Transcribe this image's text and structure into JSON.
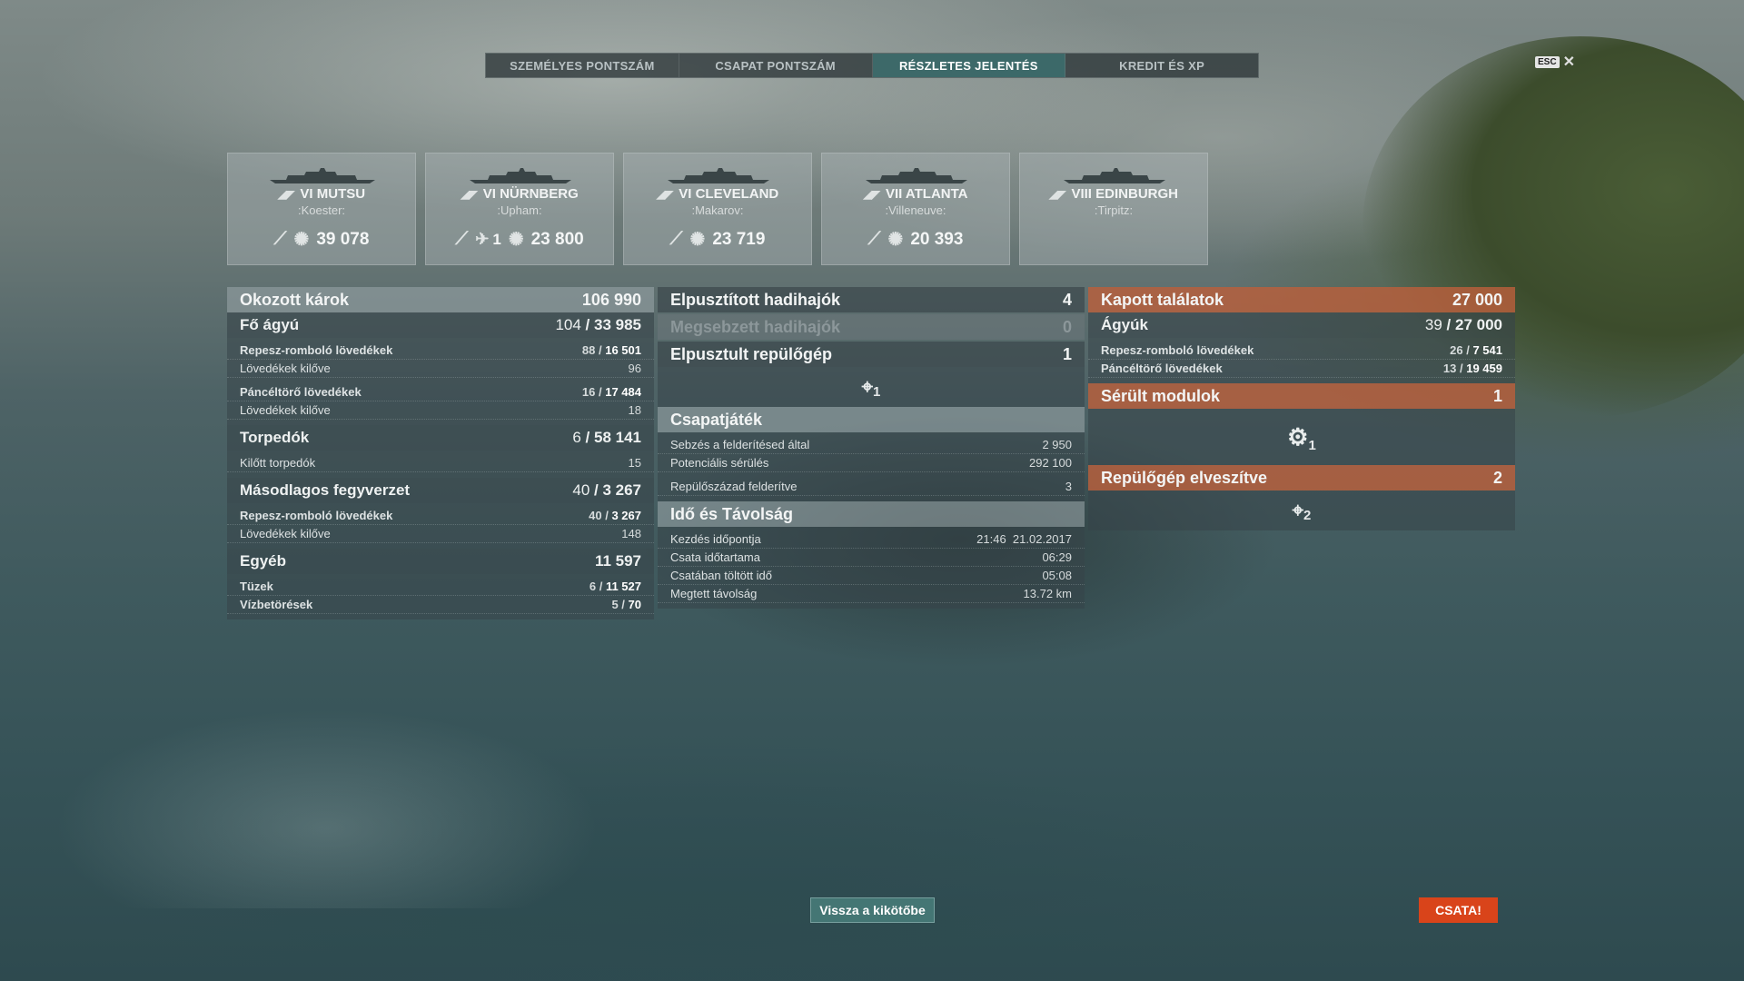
{
  "tabs": [
    {
      "label": "SZEMÉLYES PONTSZÁM"
    },
    {
      "label": "CSAPAT PONTSZÁM"
    },
    {
      "label": "RÉSZLETES JELENTÉS"
    },
    {
      "label": "KREDIT ÉS XP"
    }
  ],
  "active_tab": "RÉSZLETES JELENTÉS",
  "esc": {
    "key": "ESC",
    "close": "✕"
  },
  "ships": [
    {
      "tier": "VI",
      "name": "MUTSU",
      "player": ":Koester:",
      "damage": "39 078",
      "plane_kills": ""
    },
    {
      "tier": "VI",
      "name": "NÜRNBERG",
      "player": ":Upham:",
      "damage": "23 800",
      "plane_kills": "1"
    },
    {
      "tier": "VI",
      "name": "CLEVELAND",
      "player": ":Makarov:",
      "damage": "23 719",
      "plane_kills": ""
    },
    {
      "tier": "VII",
      "name": "ATLANTA",
      "player": ":Villeneuve:",
      "damage": "20 393",
      "plane_kills": ""
    },
    {
      "tier": "VIII",
      "name": "EDINBURGH",
      "player": ":Tirpitz:",
      "damage": "",
      "plane_kills": ""
    }
  ],
  "left": {
    "title": "Okozott károk",
    "total": "106 990",
    "main": {
      "label": "Fő ágyú",
      "hits": "104",
      "damage": "33 985"
    },
    "he": {
      "label": "Repesz-romboló lövedékek",
      "hits": "88",
      "damage": "16 501"
    },
    "he_fired": {
      "label": "Lövedékek kilőve",
      "value": "96"
    },
    "ap": {
      "label": "Páncéltörő lövedékek",
      "hits": "16",
      "damage": "17 484"
    },
    "ap_fired": {
      "label": "Lövedékek kilőve",
      "value": "18"
    },
    "torp": {
      "label": "Torpedók",
      "hits": "6",
      "damage": "58 141"
    },
    "torp_fired": {
      "label": "Kilőtt torpedók",
      "value": "15"
    },
    "secondary": {
      "label": "Másodlagos fegyverzet",
      "hits": "40",
      "damage": "3 267"
    },
    "sec_he": {
      "label": "Repesz-romboló lövedékek",
      "hits": "40",
      "damage": "3 267"
    },
    "sec_fired": {
      "label": "Lövedékek kilőve",
      "value": "148"
    },
    "other": {
      "label": "Egyéb",
      "value": "11 597"
    },
    "fires": {
      "label": "Tüzek",
      "hits": "6",
      "damage": "11 527"
    },
    "floods": {
      "label": "Vízbetörések",
      "hits": "5",
      "damage": "70"
    }
  },
  "middle": {
    "destroyed": {
      "label": "Elpusztított hadihajók",
      "value": "4"
    },
    "damaged": {
      "label": "Megsebzett hadihajók",
      "value": "0"
    },
    "planes": {
      "label": "Elpusztult repülőgép",
      "value": "1"
    },
    "planes_icon_count": "1",
    "team": {
      "label": "Csapatjáték"
    },
    "spot_damage": {
      "label": "Sebzés a felderítésed által",
      "value": "2 950"
    },
    "potential": {
      "label": "Potenciális sérülés",
      "value": "292 100"
    },
    "squadron": {
      "label": "Repülőszázad felderítve",
      "value": "3"
    },
    "time": {
      "label": "Idő és Távolság"
    },
    "start": {
      "label": "Kezdés időpontja",
      "value": "21:46  21.02.2017"
    },
    "duration": {
      "label": "Csata időtartama",
      "value": "06:29"
    },
    "alive": {
      "label": "Csatában töltött idő",
      "value": "05:08"
    },
    "distance": {
      "label": "Megtett távolság",
      "value": "13.72 km"
    }
  },
  "right": {
    "received": {
      "label": "Kapott találatok",
      "value": "27 000"
    },
    "guns": {
      "label": "Ágyúk",
      "hits": "39",
      "damage": "27 000"
    },
    "he": {
      "label": "Repesz-romboló lövedékek",
      "hits": "26",
      "damage": "7 541"
    },
    "ap": {
      "label": "Páncéltörő lövedékek",
      "hits": "13",
      "damage": "19 459"
    },
    "modules": {
      "label": "Sérült modulok",
      "value": "1"
    },
    "modules_icon_count": "1",
    "planes_lost": {
      "label": "Repülőgép elveszítve",
      "value": "2"
    },
    "planes_lost_icon_count": "2"
  },
  "buttons": {
    "back": "Vissza a kikötőbe",
    "battle": "CSATA!"
  },
  "colors": {
    "active_tab": "#3c6e6e",
    "battle_button": "#d9441a",
    "received_header": "#b95f3c"
  }
}
